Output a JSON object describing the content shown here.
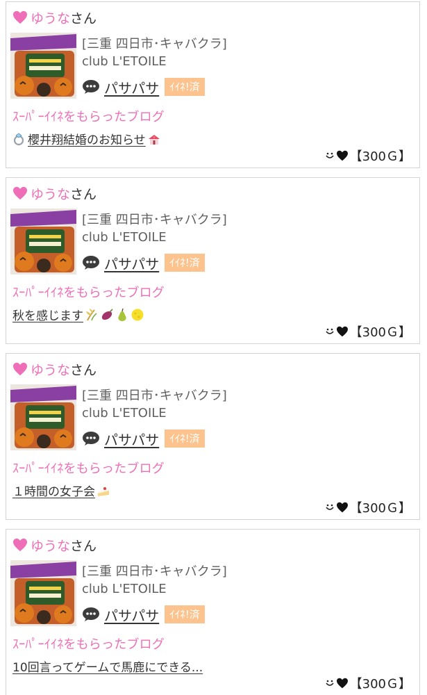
{
  "colors": {
    "accent_pink": "#ee6fb7",
    "badge_orange": "#fcc38f",
    "border": "#d4d4d4",
    "text_dark": "#333333",
    "text_gray": "#5f5f5f"
  },
  "icons": {
    "user_heart": "pink-heart-icon",
    "comment": "speech-bubble-icon",
    "points_smile": "smile-icon",
    "points_heart": "black-heart-icon"
  },
  "cards": [
    {
      "user_name": "ゆうな",
      "user_suffix": "さん",
      "shop_area": "[三重 四日市･キャバクラ]",
      "shop_name": "club L'ETOILE",
      "cast_name": "パサパサ",
      "liked_badge": "ｲｲﾈ!済",
      "section_label": "ｽｰﾊﾟｰｲｲﾈをもらったブログ",
      "blog_title": "櫻井翔結婚のお知らせ",
      "title_emojis": [
        "ring-emoji",
        "chapel-emoji"
      ],
      "points": "【300Ｇ】"
    },
    {
      "user_name": "ゆうな",
      "user_suffix": "さん",
      "shop_area": "[三重 四日市･キャバクラ]",
      "shop_name": "club L'ETOILE",
      "cast_name": "パサパサ",
      "liked_badge": "ｲｲﾈ!済",
      "section_label": "ｽｰﾊﾟｰｲｲﾈをもらったブログ",
      "blog_title": "秋を感じます",
      "title_emojis": [
        "rice-emoji",
        "sweet-potato-emoji",
        "pear-emoji",
        "moon-emoji"
      ],
      "points": "【300Ｇ】"
    },
    {
      "user_name": "ゆうな",
      "user_suffix": "さん",
      "shop_area": "[三重 四日市･キャバクラ]",
      "shop_name": "club L'ETOILE",
      "cast_name": "パサパサ",
      "liked_badge": "ｲｲﾈ!済",
      "section_label": "ｽｰﾊﾟｰｲｲﾈをもらったブログ",
      "blog_title": "１時間の女子会",
      "title_emojis": [
        "cake-emoji"
      ],
      "points": "【300Ｇ】"
    },
    {
      "user_name": "ゆうな",
      "user_suffix": "さん",
      "shop_area": "[三重 四日市･キャバクラ]",
      "shop_name": "club L'ETOILE",
      "cast_name": "パサパサ",
      "liked_badge": "ｲｲﾈ!済",
      "section_label": "ｽｰﾊﾟｰｲｲﾈをもらったブログ",
      "blog_title": "10回言ってゲームで馬鹿にできる...",
      "title_emojis": [],
      "points": "【300Ｇ】"
    }
  ]
}
